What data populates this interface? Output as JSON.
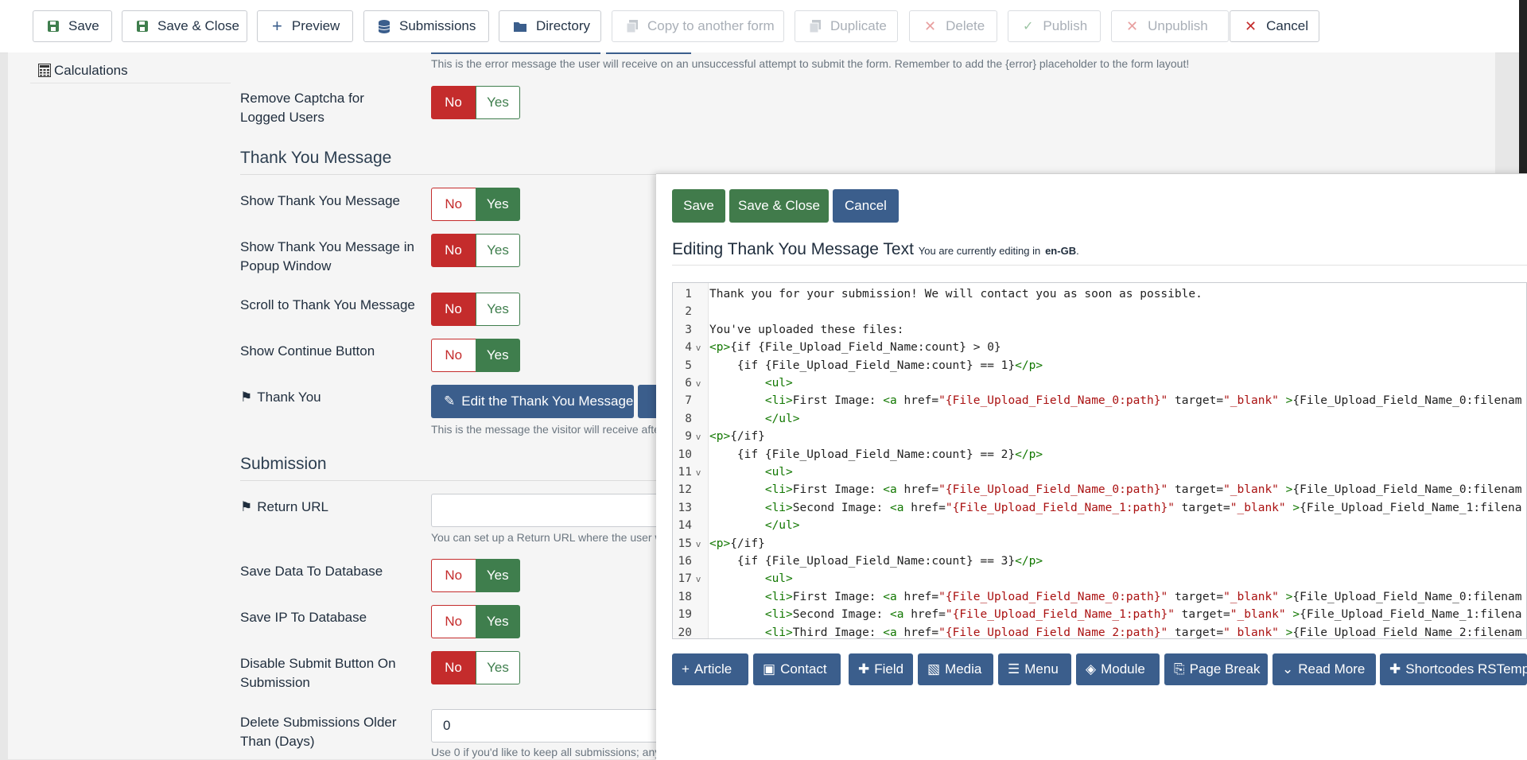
{
  "toolbar": {
    "save": "Save",
    "save_close": "Save & Close",
    "preview": "Preview",
    "submissions": "Submissions",
    "directory": "Directory",
    "copy": "Copy to another form",
    "duplicate": "Duplicate",
    "delete": "Delete",
    "publish": "Publish",
    "unpublish": "Unpublish",
    "cancel": "Cancel"
  },
  "sidebar": {
    "calculations": "Calculations"
  },
  "main": {
    "error_hint": "This is the error message the user will receive on an unsuccessful attempt to submit the form. Remember to add the {error} placeholder to the form layout!",
    "remove_captcha": "Remove Captcha for Logged Users",
    "thank_you_heading": "Thank You Message",
    "show_thank_you": "Show Thank You Message",
    "show_popup": "Show Thank You Message in Popup Window",
    "scroll_to": "Scroll to Thank You Message",
    "show_continue": "Show Continue Button",
    "thank_you_label": "Thank You",
    "edit_thank_you": "Edit the Thank You Message",
    "thank_you_hint": "This is the message the visitor will receive afte",
    "submission_heading": "Submission",
    "return_url": "Return URL",
    "return_hint": "You can set up a Return URL where the user w",
    "save_db": "Save Data To Database",
    "save_ip": "Save IP To Database",
    "disable_submit": "Disable Submit Button On Submission",
    "delete_older": "Delete Submissions Older Than (Days)",
    "delete_value": "0",
    "delete_hint": "Use 0 if you'd like to keep all submissions; any",
    "no": "No",
    "yes": "Yes"
  },
  "modal": {
    "save": "Save",
    "save_close": "Save & Close",
    "cancel": "Cancel",
    "title": "Editing Thank You Message Text",
    "subtitle": "You are currently editing in",
    "lang": "en-GB",
    "lines": [
      "Thank you for your submission! We will contact you as soon as possible.",
      "",
      "You've uploaded these files:",
      "<p>{if {File_Upload_Field_Name:count} > 0}",
      "    {if {File_Upload_Field_Name:count} == 1}</p>",
      "        <ul>",
      "        <li>First Image: <a href=\"{File_Upload_Field_Name_0:path}\" target=\"_blank\" >{File_Upload_Field_Name_0:filenam",
      "        </ul>",
      "<p>{/if}",
      "    {if {File_Upload_Field_Name:count} == 2}</p>",
      "        <ul>",
      "        <li>First Image: <a href=\"{File_Upload_Field_Name_0:path}\" target=\"_blank\" >{File_Upload_Field_Name_0:filenam",
      "        <li>Second Image: <a href=\"{File_Upload_Field_Name_1:path}\" target=\"_blank\" >{File_Upload_Field_Name_1:filena",
      "        </ul>",
      "<p>{/if}",
      "    {if {File_Upload_Field_Name:count} == 3}</p>",
      "        <ul>",
      "        <li>First Image: <a href=\"{File_Upload_Field_Name_0:path}\" target=\"_blank\" >{File_Upload_Field_Name_0:filenam",
      "        <li>Second Image: <a href=\"{File_Upload_Field_Name_1:path}\" target=\"_blank\" >{File_Upload_Field_Name_1:filena",
      "        <li>Third Image: <a href=\"{File_Upload_Field_Name_2:path}\" target=\"_blank\" >{File_Upload_Field_Name_2:filenam"
    ],
    "fold_lines": [
      4,
      6,
      9,
      11,
      15,
      17
    ],
    "editor_buttons": [
      "Article",
      "Contact",
      "Field",
      "Media",
      "Menu",
      "Module",
      "Page Break",
      "Read More",
      "Shortcodes RSTempl"
    ]
  },
  "colors": {
    "toggle_red": "#c42c2c",
    "toggle_green": "#3f7e4d",
    "btn_blue": "#3b5e8c",
    "btn_green": "#417b4b"
  }
}
